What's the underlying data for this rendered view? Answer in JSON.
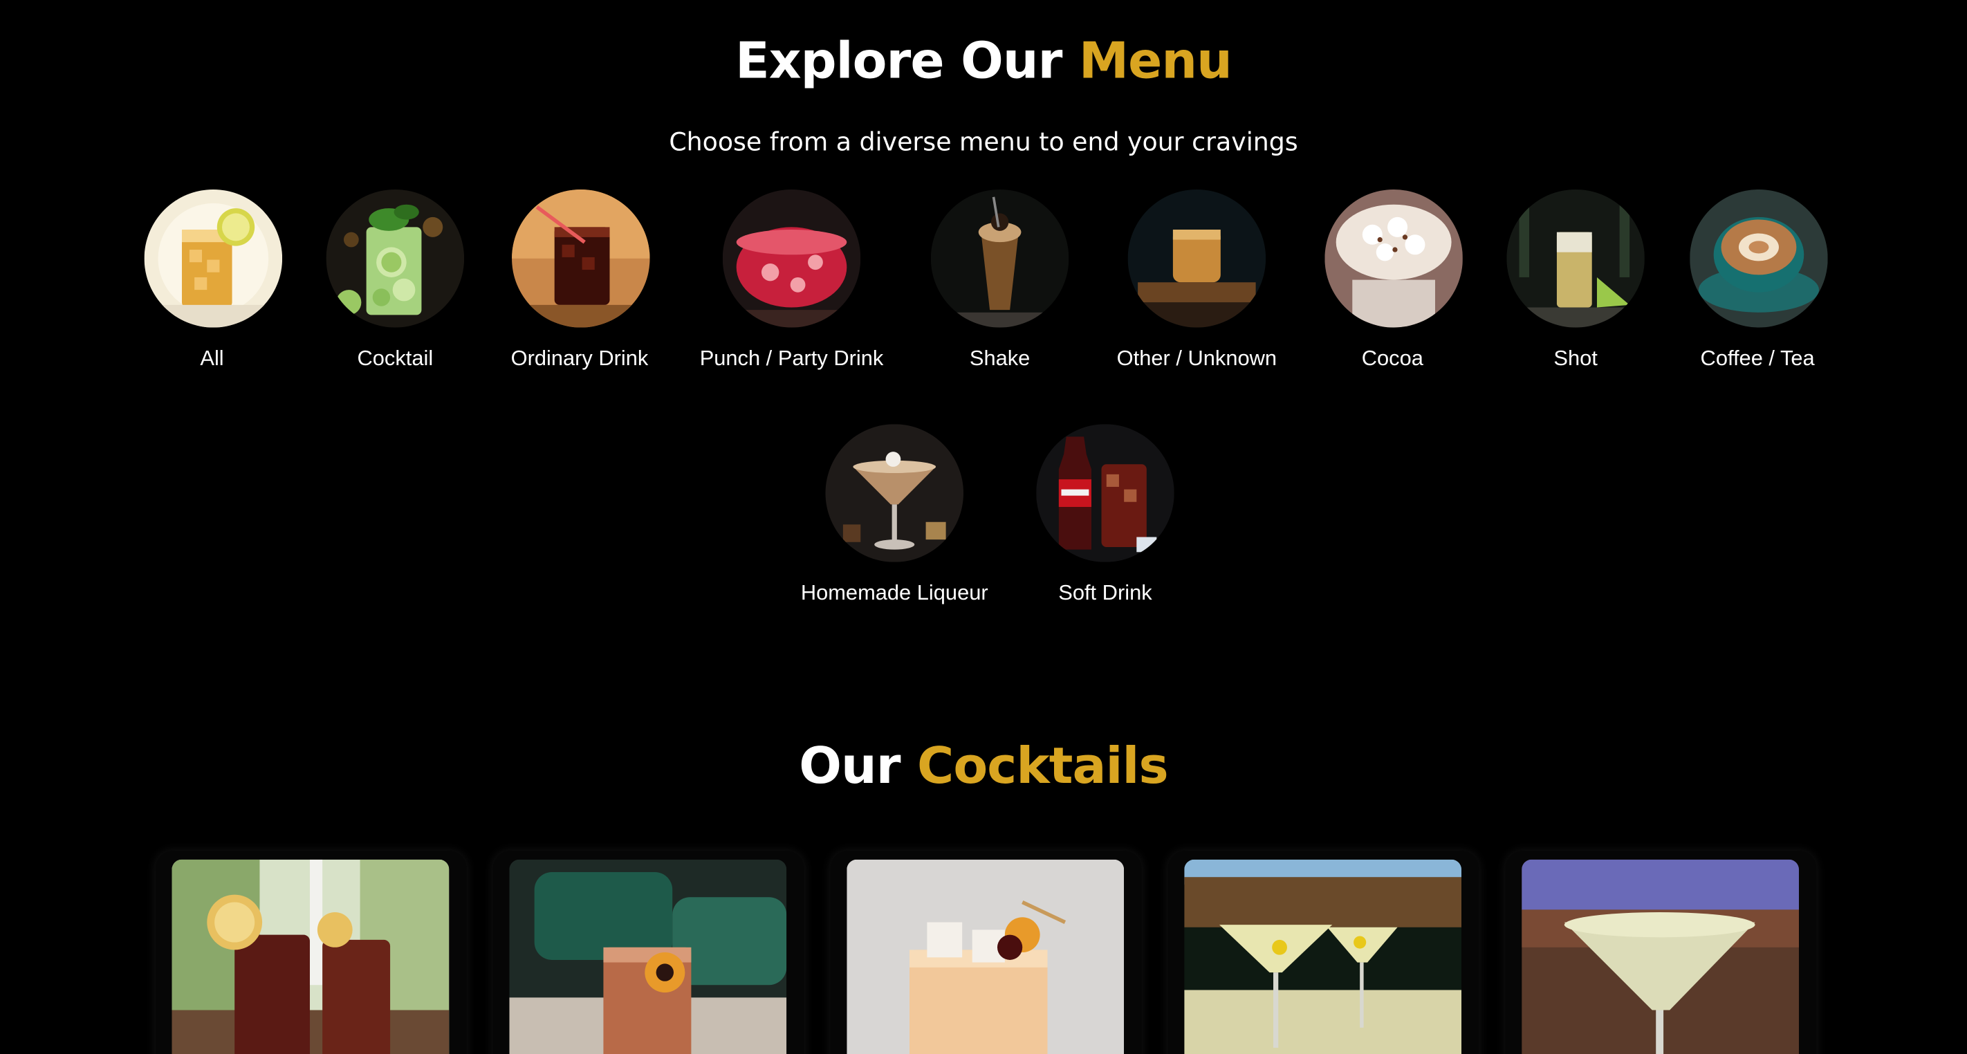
{
  "explore": {
    "title_part1": "Explore Our ",
    "title_part2": "Menu",
    "subtitle": "Choose from a diverse menu to end your cravings"
  },
  "categories": [
    {
      "label": "All"
    },
    {
      "label": "Cocktail"
    },
    {
      "label": "Ordinary Drink"
    },
    {
      "label": "Punch / Party Drink"
    },
    {
      "label": "Shake"
    },
    {
      "label": "Other / Unknown"
    },
    {
      "label": "Cocoa"
    },
    {
      "label": "Shot"
    },
    {
      "label": "Coffee / Tea"
    },
    {
      "label": "Homemade Liqueur"
    },
    {
      "label": "Soft Drink"
    }
  ],
  "cocktails": {
    "title_part1": "Our ",
    "title_part2": "Cocktails"
  },
  "colors": {
    "background": "#000000",
    "accent": "#D9A521",
    "text": "#FFFFFF"
  }
}
